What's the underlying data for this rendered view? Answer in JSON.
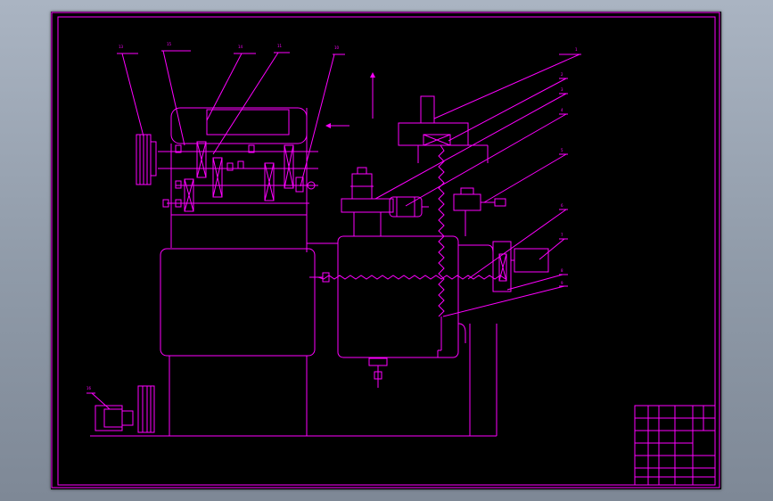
{
  "drawing": {
    "stroke_color": "#ff00ff",
    "background_color": "#000000",
    "callouts": [
      "13",
      "15",
      "14",
      "11",
      "10",
      "1",
      "2",
      "3",
      "4",
      "5",
      "6",
      "7",
      "8",
      "9",
      "16"
    ]
  }
}
